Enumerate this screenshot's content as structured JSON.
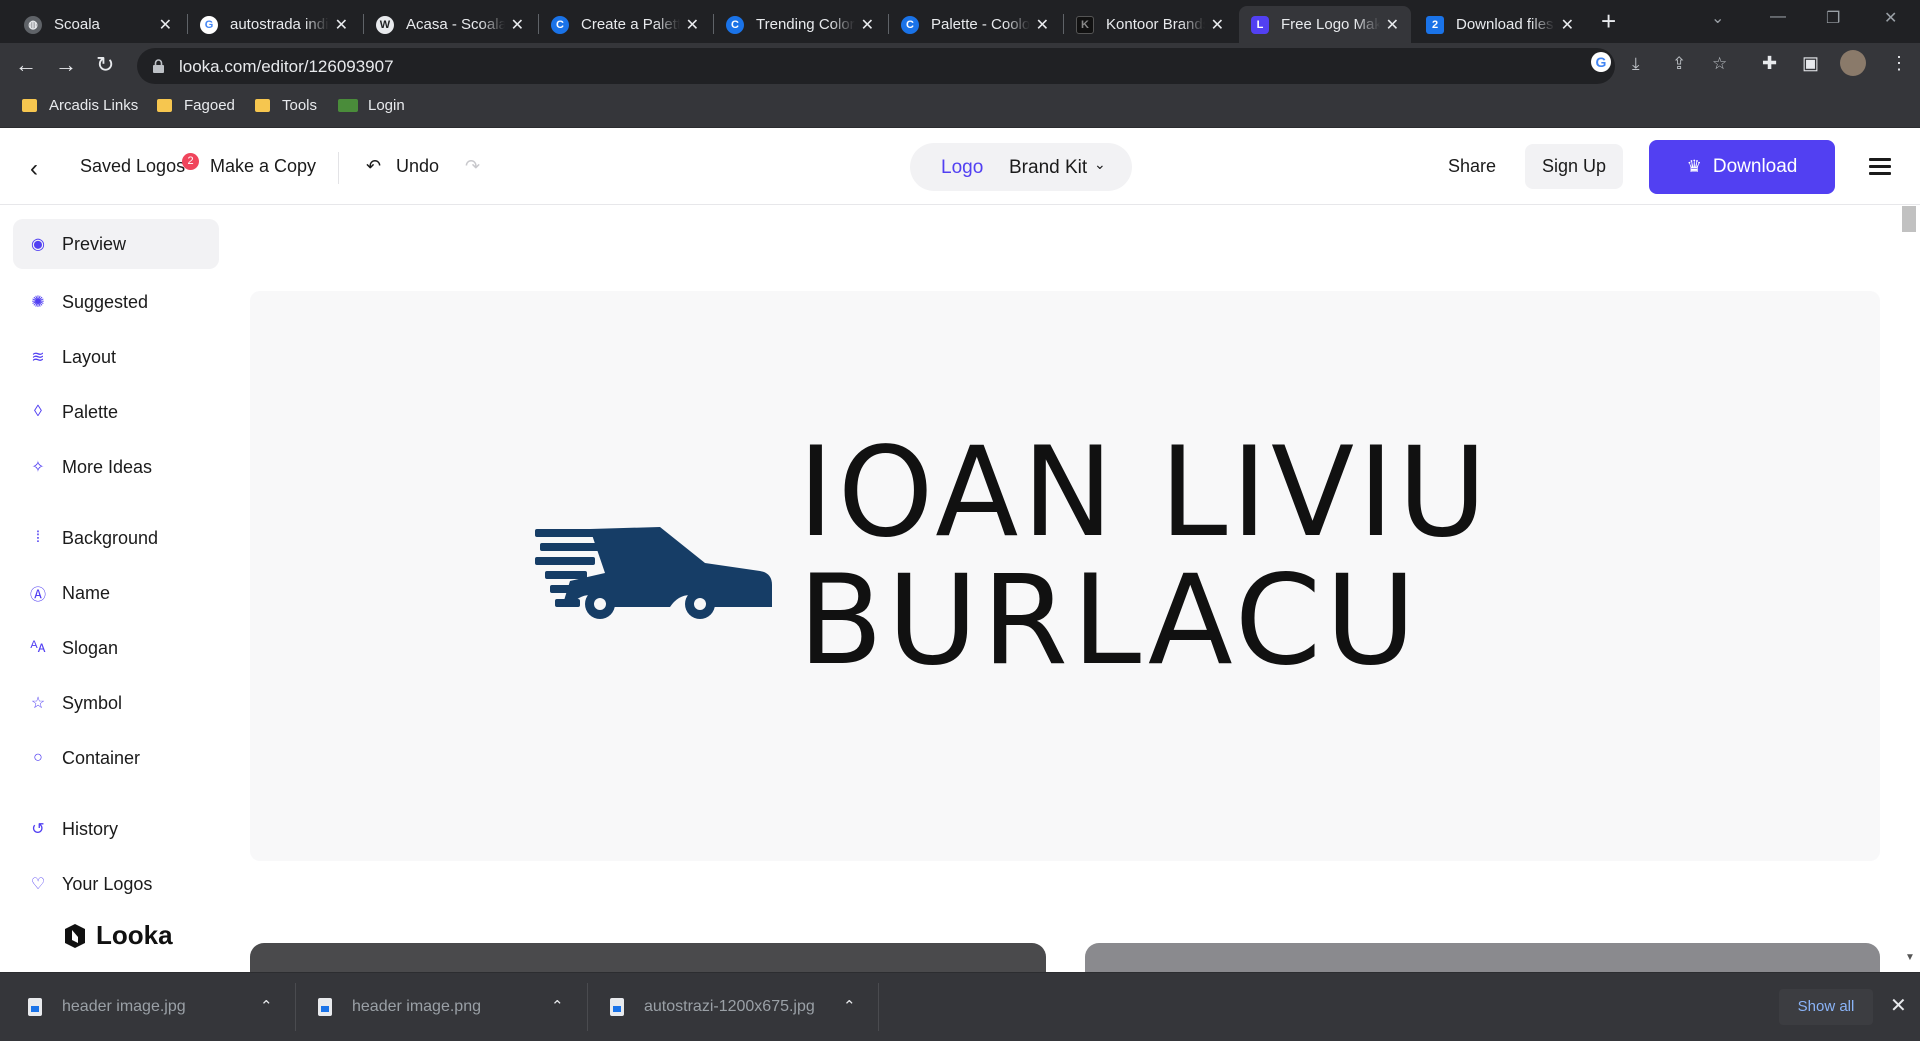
{
  "browser": {
    "tabs": [
      {
        "title": "Scoala",
        "favicon": "globe-icon"
      },
      {
        "title": "autostrada indiana",
        "favicon": "google-icon"
      },
      {
        "title": "Acasa - Scoala",
        "favicon": "wordpress-icon"
      },
      {
        "title": "Create a Palette",
        "favicon": "coolors-icon"
      },
      {
        "title": "Trending Color",
        "favicon": "coolors-icon"
      },
      {
        "title": "Palette - Coolors",
        "favicon": "coolors-icon"
      },
      {
        "title": "Kontoor Brands",
        "favicon": "kontoor-icon"
      },
      {
        "title": "Free Logo Maker",
        "favicon": "looka-icon"
      },
      {
        "title": "Download files",
        "favicon": "download-site-icon"
      }
    ],
    "active_tab_index": 7,
    "url": "looka.com/editor/126093907",
    "bookmarks": [
      "Arcadis Links",
      "Fagoed",
      "Tools",
      "Login"
    ]
  },
  "header": {
    "saved_logos": "Saved Logos",
    "saved_count": "2",
    "make_copy": "Make a Copy",
    "undo": "Undo",
    "toggle_logo": "Logo",
    "toggle_brand_kit": "Brand Kit",
    "share": "Share",
    "sign_up": "Sign Up",
    "download": "Download"
  },
  "sidebar": {
    "items": [
      {
        "label": "Preview",
        "icon": "eye-icon",
        "active": true
      },
      {
        "label": "Suggested",
        "icon": "lightbulb-icon"
      },
      {
        "label": "Layout",
        "icon": "layers-icon"
      },
      {
        "label": "Palette",
        "icon": "droplet-icon"
      },
      {
        "label": "More Ideas",
        "icon": "magic-wand-icon"
      },
      {
        "label": "Background",
        "icon": "background-grid-icon"
      },
      {
        "label": "Name",
        "icon": "text-box-icon"
      },
      {
        "label": "Slogan",
        "icon": "font-icon"
      },
      {
        "label": "Symbol",
        "icon": "star-icon"
      },
      {
        "label": "Container",
        "icon": "circle-icon"
      },
      {
        "label": "History",
        "icon": "history-icon"
      },
      {
        "label": "Your Logos",
        "icon": "heart-icon"
      }
    ],
    "brand": "Looka"
  },
  "logo": {
    "line1": "IOAN LIVIU",
    "line2": "BURLACU",
    "symbol": "fast-car-icon",
    "symbol_color": "#163d66",
    "text_color": "#111111",
    "background": "#f8f8f9"
  },
  "colors": {
    "accent": "#5240f2",
    "badge": "#f0455c"
  },
  "downloads": [
    {
      "name": "header image.jpg"
    },
    {
      "name": "header image.png"
    },
    {
      "name": "autostrazi-1200x675.jpg"
    }
  ],
  "downloads_show_all": "Show all"
}
